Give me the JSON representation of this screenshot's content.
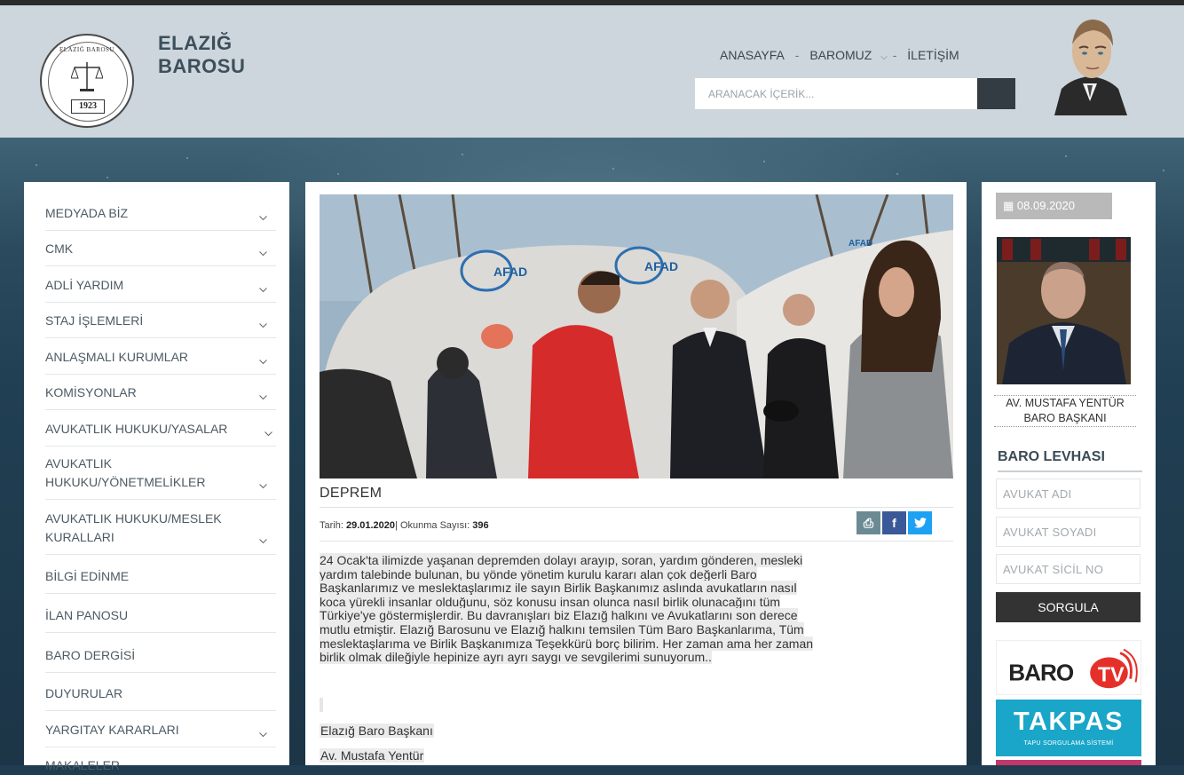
{
  "site": {
    "brand_line1": "ELAZIĞ",
    "brand_line2": "BAROSU",
    "logo_ring_text": "ELAZIĞ BAROSU",
    "logo_year": "1923"
  },
  "topnav": {
    "items": [
      "ANASAYFA",
      "BAROMUZ",
      "İLETİŞİM"
    ],
    "separator": "-"
  },
  "search": {
    "placeholder": "ARANACAK İÇERİK..."
  },
  "sidebar": {
    "items": [
      {
        "label": "MEDYADA BİZ",
        "has_submenu": true
      },
      {
        "label": "CMK",
        "has_submenu": true
      },
      {
        "label": "ADLİ YARDIM",
        "has_submenu": true
      },
      {
        "label": "STAJ İŞLEMLERİ",
        "has_submenu": true
      },
      {
        "label": "ANLAŞMALI KURUMLAR",
        "has_submenu": true
      },
      {
        "label": "KOMİSYONLAR",
        "has_submenu": true
      },
      {
        "label": "AVUKATLIK HUKUKU/YASALAR",
        "has_submenu": true
      },
      {
        "label": "AVUKATLIK HUKUKU/YÖNETMELİKLER",
        "has_submenu": true
      },
      {
        "label": "AVUKATLIK HUKUKU/MESLEK KURALLARI",
        "has_submenu": true
      },
      {
        "label": "BİLGİ EDİNME",
        "has_submenu": false
      },
      {
        "label": "İLAN PANOSU",
        "has_submenu": false
      },
      {
        "label": "BARO DERGİSİ",
        "has_submenu": false
      },
      {
        "label": "DUYURULAR",
        "has_submenu": false
      },
      {
        "label": "YARGITAY KARARLARI",
        "has_submenu": true
      },
      {
        "label": "MAKALELER",
        "has_submenu": false
      }
    ],
    "item_label_lines": {
      "7": [
        "AVUKATLIK",
        "HUKUKU/YÖNETMELİKLER"
      ],
      "8": [
        "AVUKATLIK HUKUKU/MESLEK",
        "KURALLARI"
      ]
    }
  },
  "article": {
    "photo_tent_text": "AFAD",
    "title": "DEPREM",
    "date_label": "Tarih:",
    "date_value": "29.01.2020",
    "reads_label": "| Okunma Sayısı:",
    "reads_value": "396",
    "body_lines": [
      "24 Ocak'ta ilimizde yaşanan depremden dolayı arayıp, soran, yardım gönderen, mesleki",
      "yardım talebinde bulunan, bu yönde yönetim kurulu kararı alan çok değerli Baro",
      "Başkanlarımız ve meslektaşlarımız ile sayın Birlik Başkanımız aslında avukatların nasıl",
      "koca yürekli insanlar olduğunu, söz konusu insan olunca nasıl birlik olunacağını tüm",
      "Türkiye'ye göstermişlerdir. Bu davranışları biz Elazığ halkını ve Avukatlarını son derece",
      "mutlu etmiştir. Elazığ Barosunu ve Elazığ halkını temsilen Tüm Baro Başkanlarıma, Tüm",
      "meslektaşlarıma ve Birlik Başkanımıza Teşekkürü borç bilirim. Her zaman ama her zaman",
      "birlik olmak dileğiyle hepinize ayrı ayrı saygı ve sevgilerimi sunuyorum.."
    ],
    "signature": [
      "Elazığ Baro Başkanı",
      "Av. Mustafa Yentür"
    ],
    "share_buttons": [
      {
        "icon": "print-icon",
        "glyph": "⎙",
        "color": "#6c8a94"
      },
      {
        "icon": "facebook-icon",
        "glyph": "f",
        "color": "#3b5998"
      },
      {
        "icon": "twitter-icon",
        "glyph": "t",
        "color": "#1da1f2"
      }
    ]
  },
  "right": {
    "date": "08.09.2020",
    "president_name": "AV. MUSTAFA YENTÜR",
    "president_title": "BARO BAŞKANI",
    "levha_title": "BARO LEVHASI",
    "inputs": [
      {
        "placeholder": "AVUKAT ADI"
      },
      {
        "placeholder": "AVUKAT SOYADI"
      },
      {
        "placeholder": "AVUKAT SİCİL NO"
      }
    ],
    "query_button": "SORGULA",
    "banner1_text": "BARO",
    "banner1_tv": "TV",
    "banner2_title": "TAKPAS",
    "banner2_sub": "TAPU SORGULAMA SİSTEMİ"
  },
  "colors": {
    "header_bg": "#ccd6dc",
    "dark_button": "#333333",
    "date_badge": "#b9b9b9",
    "takpas": "#1aa6c8",
    "barotv_red": "#e5302a"
  }
}
